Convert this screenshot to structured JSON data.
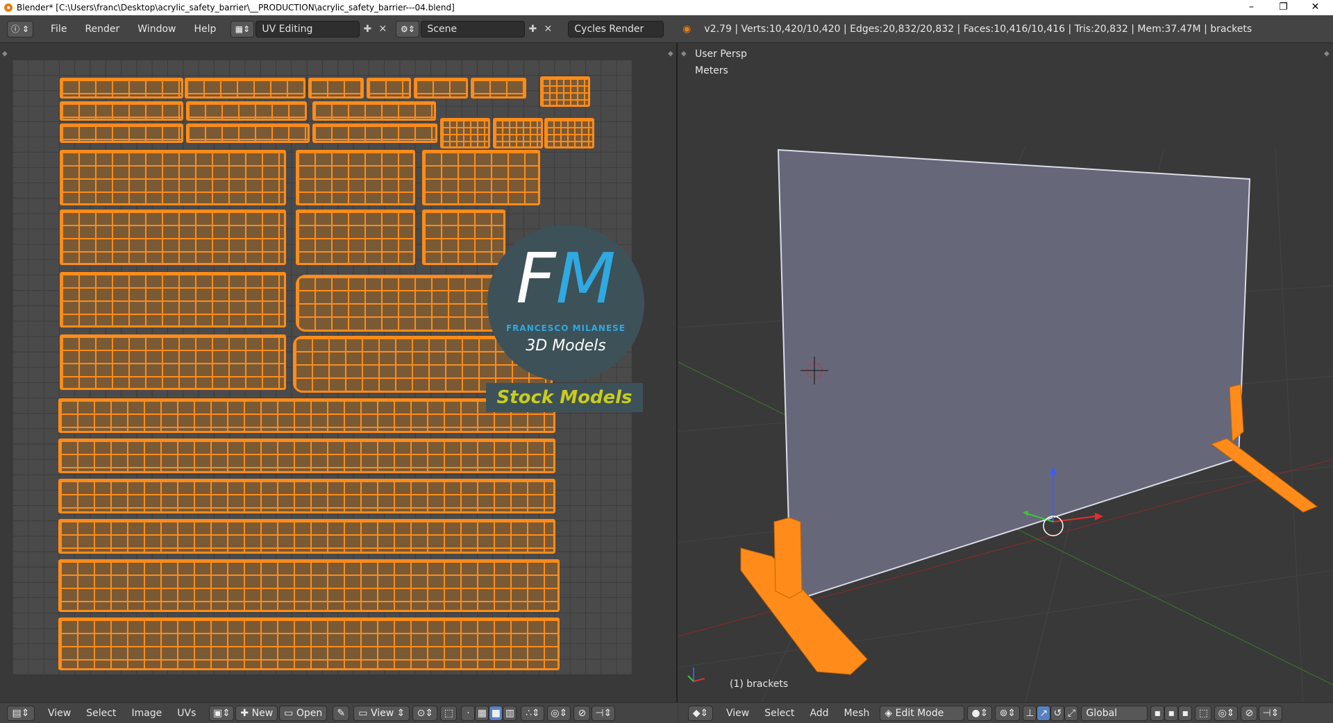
{
  "window": {
    "title": "Blender* [C:\\Users\\franc\\Desktop\\acrylic_safety_barrier\\__PRODUCTION\\acrylic_safety_barrier---04.blend]",
    "controls": [
      "–",
      "❐",
      "✕"
    ]
  },
  "header": {
    "menus": [
      "File",
      "Render",
      "Window",
      "Help"
    ],
    "screen_layout": "UV Editing",
    "scene": "Scene",
    "render_engine": "Cycles Render",
    "stats": "v2.79 | Verts:10,420/10,420 | Edges:20,832/20,832 | Faces:10,416/10,416 | Tris:20,832 | Mem:37.47M | brackets"
  },
  "uv_editor": {
    "footer_menus": [
      "View",
      "Select",
      "Image",
      "UVs"
    ],
    "new_label": "New",
    "open_label": "Open",
    "view_label": "View"
  },
  "watermark": {
    "letter_f": "F",
    "letter_m": "M",
    "name": "FRANCESCO MILANESE",
    "subtitle": "3D Models",
    "banner": "Stock Models"
  },
  "viewport": {
    "view_name": "User Persp",
    "units": "Meters",
    "object_label": "(1) brackets",
    "footer_menus": [
      "View",
      "Select",
      "Add",
      "Mesh"
    ],
    "mode": "Edit Mode",
    "orientation": "Global"
  },
  "colors": {
    "uv_wire": "#ff8c1a",
    "panel": "#dcdce8"
  }
}
